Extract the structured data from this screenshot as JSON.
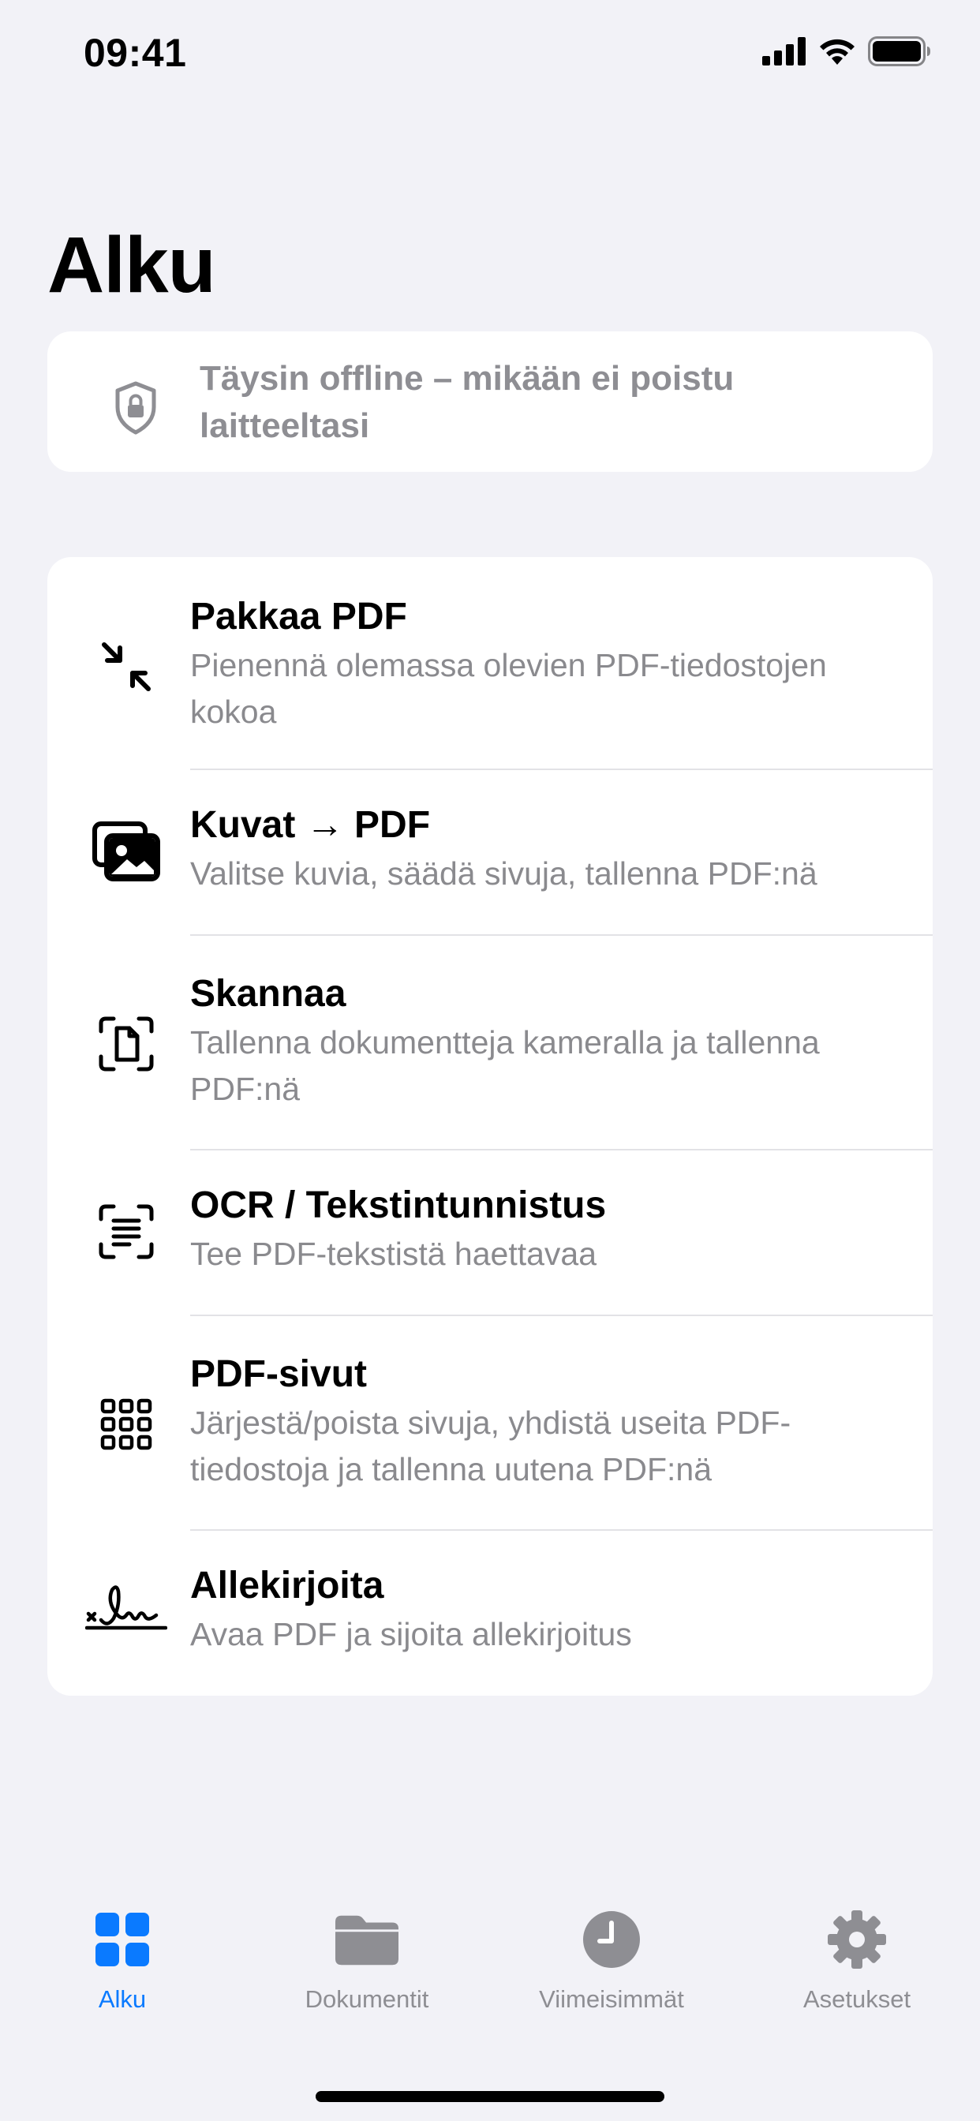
{
  "status_bar": {
    "time": "09:41"
  },
  "page": {
    "title": "Alku"
  },
  "offline_notice": {
    "text": "Täysin offline – mikään ei poistu laitteeltasi"
  },
  "tools": [
    {
      "icon": "compress-arrows-icon",
      "title": "Pakkaa PDF",
      "subtitle": "Pienennä olemassa olevien PDF-tiedostojen kokoa"
    },
    {
      "icon": "photos-icon",
      "title": "Kuvat → PDF",
      "subtitle": "Valitse kuvia, säädä sivuja, tallenna PDF:nä"
    },
    {
      "icon": "document-scanner-icon",
      "title": "Skannaa",
      "subtitle": "Tallenna dokumentteja kameralla ja tallenna PDF:nä"
    },
    {
      "icon": "text-viewfinder-icon",
      "title": "OCR / Tekstintunnistus",
      "subtitle": "Tee PDF-tekstistä haettavaa"
    },
    {
      "icon": "grid-icon",
      "title": "PDF-sivut",
      "subtitle": "Järjestä/poista sivuja, yhdistä useita PDF-tiedostoja ja tallenna uutena PDF:nä"
    },
    {
      "icon": "signature-icon",
      "title": "Allekirjoita",
      "subtitle": "Avaa PDF ja sijoita allekirjoitus"
    }
  ],
  "tab_bar": {
    "items": [
      {
        "icon": "grid-squares-icon",
        "label": "Alku",
        "active": true
      },
      {
        "icon": "folder-icon",
        "label": "Dokumentit",
        "active": false
      },
      {
        "icon": "clock-icon",
        "label": "Viimeisimmät",
        "active": false
      },
      {
        "icon": "gear-icon",
        "label": "Asetukset",
        "active": false
      }
    ]
  },
  "colors": {
    "accent": "#0A7AFF",
    "background": "#F2F2F7",
    "secondary_text": "#8E8E93"
  }
}
